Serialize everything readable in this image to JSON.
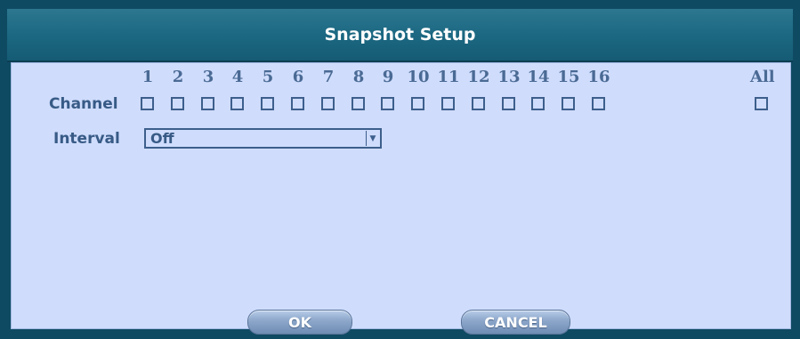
{
  "dialog": {
    "title": "Snapshot Setup"
  },
  "channel": {
    "label": "Channel",
    "numbers": [
      "1",
      "2",
      "3",
      "4",
      "5",
      "6",
      "7",
      "8",
      "9",
      "10",
      "11",
      "12",
      "13",
      "14",
      "15",
      "16"
    ],
    "all_label": "All"
  },
  "interval": {
    "label": "Interval",
    "value": "Off"
  },
  "buttons": {
    "ok": "OK",
    "cancel": "CANCEL"
  },
  "colors": {
    "frame": "#0f4a63",
    "titlebar": "#1c6882",
    "panel": "#cfdcfc",
    "text": "#385b86"
  }
}
